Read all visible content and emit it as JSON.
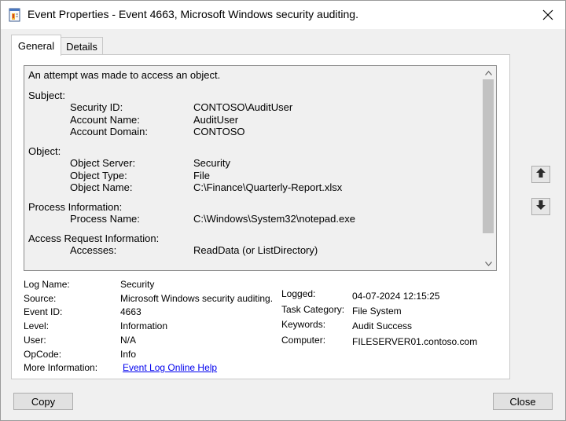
{
  "window": {
    "title": "Event Properties - Event 4663, Microsoft Windows security auditing."
  },
  "tabs": [
    {
      "label": "General",
      "active": true
    },
    {
      "label": "Details",
      "active": false
    }
  ],
  "description": {
    "intro": "An attempt was made to access an object.",
    "sections": [
      {
        "heading": "Subject:",
        "fields": [
          {
            "label": "Security ID:",
            "value": "CONTOSO\\AuditUser"
          },
          {
            "label": "Account Name:",
            "value": "AuditUser"
          },
          {
            "label": "Account Domain:",
            "value": "CONTOSO"
          }
        ]
      },
      {
        "heading": "Object:",
        "fields": [
          {
            "label": "Object Server:",
            "value": "Security"
          },
          {
            "label": "Object Type:",
            "value": "File"
          },
          {
            "label": "Object Name:",
            "value": "C:\\Finance\\Quarterly-Report.xlsx"
          }
        ]
      },
      {
        "heading": "Process Information:",
        "fields": [
          {
            "label": "Process Name:",
            "value": "C:\\Windows\\System32\\notepad.exe"
          }
        ]
      },
      {
        "heading": "Access Request Information:",
        "fields": [
          {
            "label": "Accesses:",
            "value": "ReadData (or ListDirectory)"
          }
        ]
      }
    ]
  },
  "details": {
    "log_name": {
      "label": "Log Name:",
      "value": "Security"
    },
    "source": {
      "label": "Source:",
      "value": "Microsoft Windows security auditing."
    },
    "event_id": {
      "label": "Event ID:",
      "value": "4663"
    },
    "level": {
      "label": "Level:",
      "value": "Information"
    },
    "user": {
      "label": "User:",
      "value": "N/A"
    },
    "opcode": {
      "label": "OpCode:",
      "value": "Info"
    },
    "more_info": {
      "label": "More Information:",
      "value": "Event Log Online Help"
    },
    "logged": {
      "label": "Logged:",
      "value": "04-07-2024 12:15:25"
    },
    "task_category": {
      "label": "Task Category:",
      "value": "File System"
    },
    "keywords": {
      "label": "Keywords:",
      "value": "Audit Success"
    },
    "computer": {
      "label": "Computer:",
      "value": "FILESERVER01.contoso.com"
    }
  },
  "buttons": {
    "copy": "Copy",
    "close": "Close"
  },
  "icons": {
    "app": "event-viewer-icon",
    "close": "close-icon",
    "previous": "arrow-up-icon",
    "next": "arrow-down-icon"
  }
}
